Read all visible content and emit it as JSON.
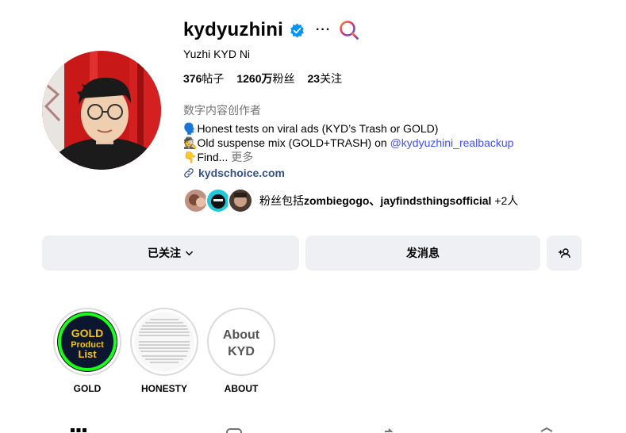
{
  "profile": {
    "username": "kydyuzhini",
    "full_name": "Yuzhi KYD Ni",
    "stats": {
      "posts_count": "376",
      "posts_label": "帖子",
      "followers_count": "1260万",
      "followers_label": "粉丝",
      "following_count": "23",
      "following_label": "关注"
    },
    "category": "数字内容创作者",
    "bio": {
      "line1_emoji": "🗣️",
      "line1_text": "Honest tests on viral ads (KYD’s Trash or GOLD)",
      "line2_emoji": "🕵️",
      "line2_text": "Old suspense mix (GOLD+TRASH) on ",
      "line2_mention": "@kydyuzhini_realbackup",
      "line3_emoji": "👇",
      "line3_text": "Find...",
      "more_label": "更多"
    },
    "link": "kydschoice.com",
    "followed_by": {
      "prefix": "粉丝包括",
      "names": "zombiegogo、jayfindsthingsofficial",
      "suffix": " +2人"
    },
    "more_icon": "···"
  },
  "icons": {
    "verified": "verified-badge-icon",
    "search": "search-icon",
    "link": "link-icon",
    "chevron": "chevron-down-icon",
    "add_user": "add-user-icon"
  },
  "colors": {
    "verified_blue": "#0095f6",
    "link_blue": "#385185",
    "mention_blue": "#4150f7",
    "button_bg": "#eff0f3",
    "muted_text": "#737373"
  },
  "buttons": {
    "following_label": "已关注",
    "message_label": "发消息"
  },
  "highlights": [
    {
      "label": "GOLD",
      "cover_text": "GOLD Product List"
    },
    {
      "label": "HONESTY",
      "cover_text": ""
    },
    {
      "label": "ABOUT",
      "cover_text": "About KYD"
    }
  ]
}
